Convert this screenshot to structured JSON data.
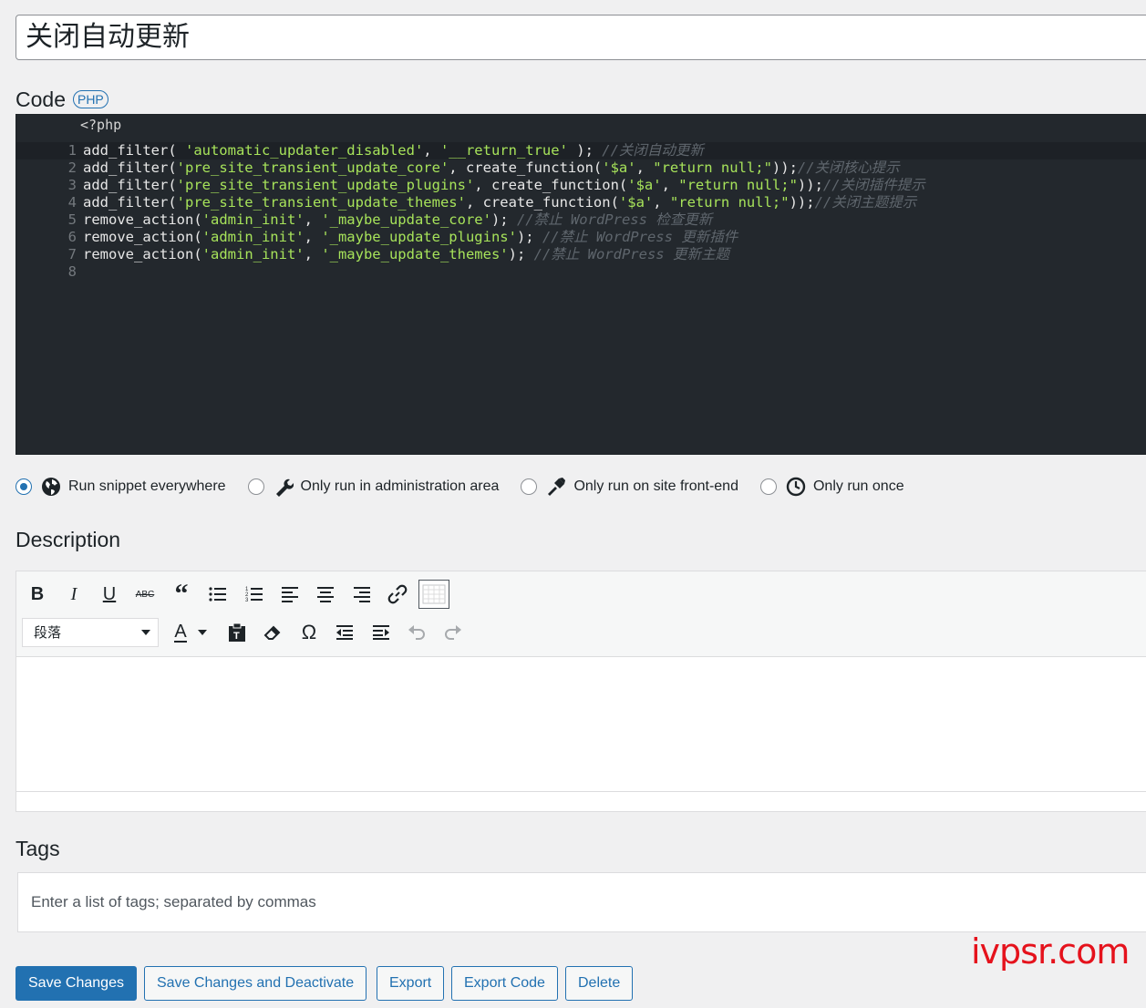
{
  "snippet": {
    "title": "关闭自动更新"
  },
  "code_section": {
    "label": "Code",
    "language_badge": "PHP",
    "php_open_tag": "<?php",
    "lines": [
      {
        "n": "1",
        "tokens": [
          {
            "t": "fn",
            "v": "add_filter( "
          },
          {
            "t": "str",
            "v": "'automatic_updater_disabled'"
          },
          {
            "t": "fn",
            "v": ", "
          },
          {
            "t": "str",
            "v": "'__return_true'"
          },
          {
            "t": "fn",
            "v": " ); "
          },
          {
            "t": "cmt",
            "v": "//关闭自动更新"
          }
        ]
      },
      {
        "n": "2",
        "tokens": [
          {
            "t": "fn",
            "v": "add_filter("
          },
          {
            "t": "str",
            "v": "'pre_site_transient_update_core'"
          },
          {
            "t": "fn",
            "v": ", create_function("
          },
          {
            "t": "str",
            "v": "'$a'"
          },
          {
            "t": "fn",
            "v": ", "
          },
          {
            "t": "str",
            "v": "\"return null;\""
          },
          {
            "t": "fn",
            "v": "));"
          },
          {
            "t": "cmt",
            "v": "//关闭核心提示"
          }
        ]
      },
      {
        "n": "3",
        "tokens": [
          {
            "t": "fn",
            "v": "add_filter("
          },
          {
            "t": "str",
            "v": "'pre_site_transient_update_plugins'"
          },
          {
            "t": "fn",
            "v": ", create_function("
          },
          {
            "t": "str",
            "v": "'$a'"
          },
          {
            "t": "fn",
            "v": ", "
          },
          {
            "t": "str",
            "v": "\"return null;\""
          },
          {
            "t": "fn",
            "v": "));"
          },
          {
            "t": "cmt",
            "v": "//关闭插件提示"
          }
        ]
      },
      {
        "n": "4",
        "tokens": [
          {
            "t": "fn",
            "v": "add_filter("
          },
          {
            "t": "str",
            "v": "'pre_site_transient_update_themes'"
          },
          {
            "t": "fn",
            "v": ", create_function("
          },
          {
            "t": "str",
            "v": "'$a'"
          },
          {
            "t": "fn",
            "v": ", "
          },
          {
            "t": "str",
            "v": "\"return null;\""
          },
          {
            "t": "fn",
            "v": "));"
          },
          {
            "t": "cmt",
            "v": "//关闭主题提示"
          }
        ]
      },
      {
        "n": "5",
        "tokens": [
          {
            "t": "fn",
            "v": "remove_action("
          },
          {
            "t": "str",
            "v": "'admin_init'"
          },
          {
            "t": "fn",
            "v": ", "
          },
          {
            "t": "str",
            "v": "'_maybe_update_core'"
          },
          {
            "t": "fn",
            "v": "); "
          },
          {
            "t": "cmt",
            "v": "//禁止 WordPress 检查更新"
          }
        ]
      },
      {
        "n": "6",
        "tokens": [
          {
            "t": "fn",
            "v": "remove_action("
          },
          {
            "t": "str",
            "v": "'admin_init'"
          },
          {
            "t": "fn",
            "v": ", "
          },
          {
            "t": "str",
            "v": "'_maybe_update_plugins'"
          },
          {
            "t": "fn",
            "v": "); "
          },
          {
            "t": "cmt",
            "v": "//禁止 WordPress 更新插件"
          }
        ]
      },
      {
        "n": "7",
        "tokens": [
          {
            "t": "fn",
            "v": "remove_action("
          },
          {
            "t": "str",
            "v": "'admin_init'"
          },
          {
            "t": "fn",
            "v": ", "
          },
          {
            "t": "str",
            "v": "'_maybe_update_themes'"
          },
          {
            "t": "fn",
            "v": "); "
          },
          {
            "t": "cmt",
            "v": "//禁止 WordPress 更新主题"
          }
        ]
      },
      {
        "n": "8",
        "tokens": []
      }
    ],
    "colors": {
      "background": "#23282d",
      "string": "#a7e35a",
      "comment": "#5f666d",
      "code": "#e7e7e7"
    }
  },
  "scope": {
    "options": [
      {
        "label": "Run snippet everywhere",
        "icon": "globe-icon",
        "checked": true
      },
      {
        "label": "Only run in administration area",
        "icon": "wrench-icon",
        "checked": false
      },
      {
        "label": "Only run on site front-end",
        "icon": "hammer-icon",
        "checked": false
      },
      {
        "label": "Only run once",
        "icon": "clock-icon",
        "checked": false
      }
    ]
  },
  "description": {
    "label": "Description",
    "format_select_value": "段落",
    "toolbar_row1": [
      "bold-icon",
      "italic-icon",
      "underline-icon",
      "strikethrough-icon",
      "blockquote-icon",
      "bullet-list-icon",
      "numbered-list-icon",
      "align-left-icon",
      "align-center-icon",
      "align-right-icon",
      "link-icon",
      "toolbar-toggle-icon"
    ],
    "toolbar_row2": [
      "text-color-icon",
      "paste-text-icon",
      "clear-formatting-icon",
      "special-character-icon",
      "outdent-icon",
      "indent-icon",
      "undo-icon",
      "redo-icon"
    ],
    "body": ""
  },
  "tags": {
    "label": "Tags",
    "placeholder": "Enter a list of tags; separated by commas"
  },
  "actions": {
    "save": "Save Changes",
    "save_deactivate": "Save Changes and Deactivate",
    "export": "Export",
    "export_code": "Export Code",
    "delete": "Delete"
  },
  "watermark": "ivpsr.com",
  "accent_color": "#2271b1"
}
